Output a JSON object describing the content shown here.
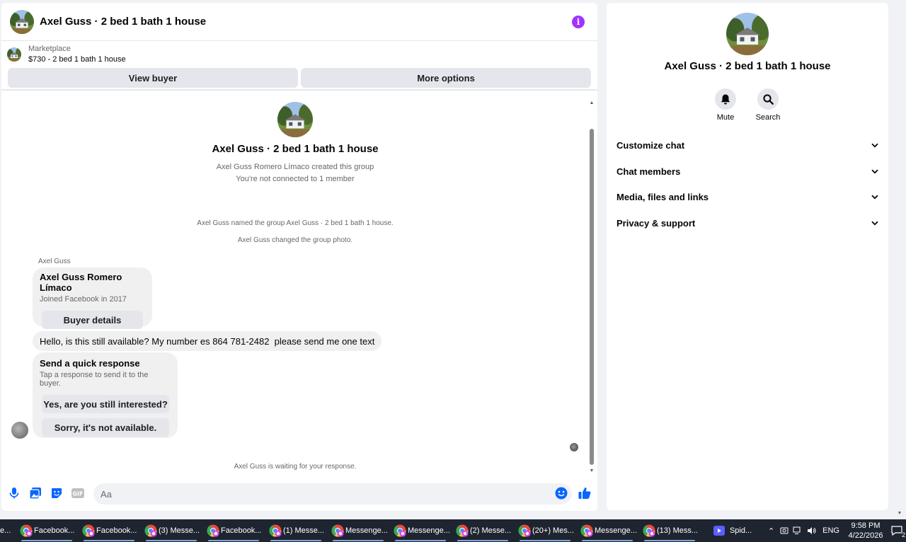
{
  "chat": {
    "title": "Axel Guss · 2 bed 1 bath 1 house",
    "info_icon": "i",
    "marketplace_label": "Marketplace",
    "listing": "$730 - 2 bed 1 bath 1 house",
    "view_buyer": "View buyer",
    "more_options": "More options",
    "intro_title": "Axel Guss · 2 bed 1 bath 1 house",
    "intro_created": "Axel Guss Romero Límaco created this group",
    "intro_connected": "You're not connected to 1 member",
    "sys_named": "Axel Guss named the group Axel Guss · 2 bed 1 bath 1 house.",
    "sys_photo": "Axel Guss changed the group photo.",
    "sender": "Axel Guss",
    "buyer_name": "Axel Guss Romero Límaco",
    "buyer_joined": "Joined Facebook in 2017",
    "buyer_details": "Buyer details",
    "message": "Hello, is this still available? My number es 864 781-2482  please send me one text",
    "quick_title": "Send a quick response",
    "quick_sub": "Tap a response to send it to the buyer.",
    "quick_1": "Yes, are you still interested?",
    "quick_2": "Sorry, it's not available.",
    "waiting": "Axel Guss is waiting for your response.",
    "composer_placeholder": "Aa",
    "composer_value": ""
  },
  "details": {
    "title": "Axel Guss · 2 bed 1 bath 1 house",
    "mute": "Mute",
    "search": "Search",
    "sections": [
      "Customize chat",
      "Chat members",
      "Media, files and links",
      "Privacy & support"
    ]
  },
  "taskbar": {
    "first": "e...",
    "items": [
      "Facebook...",
      "Facebook...",
      "(3) Messe...",
      "Facebook...",
      "(1) Messe...",
      "Messenge...",
      "Messenge...",
      "(2) Messe...",
      "(20+) Mes...",
      "Messenge...",
      "(13) Mess..."
    ],
    "video_app": "Spid...",
    "lang": "ENG",
    "time": "9:58 PM",
    "date": "4/22/2026",
    "notifications": "2"
  },
  "colors": {
    "messenger_blue": "#0866ff",
    "info_purple": "#a033ff",
    "bubble_gray": "#f0f0f0",
    "button_gray": "#e4e6eb",
    "taskbar": "#1f2530"
  },
  "icons": [
    "info-icon",
    "mic-icon",
    "image-icon",
    "sticker-icon",
    "gif-icon",
    "emoji-icon",
    "like-icon",
    "bell-icon",
    "search-icon",
    "chevron-down-icon",
    "chrome-icon",
    "video-icon",
    "wifi-icon",
    "volume-icon",
    "notification-icon"
  ]
}
